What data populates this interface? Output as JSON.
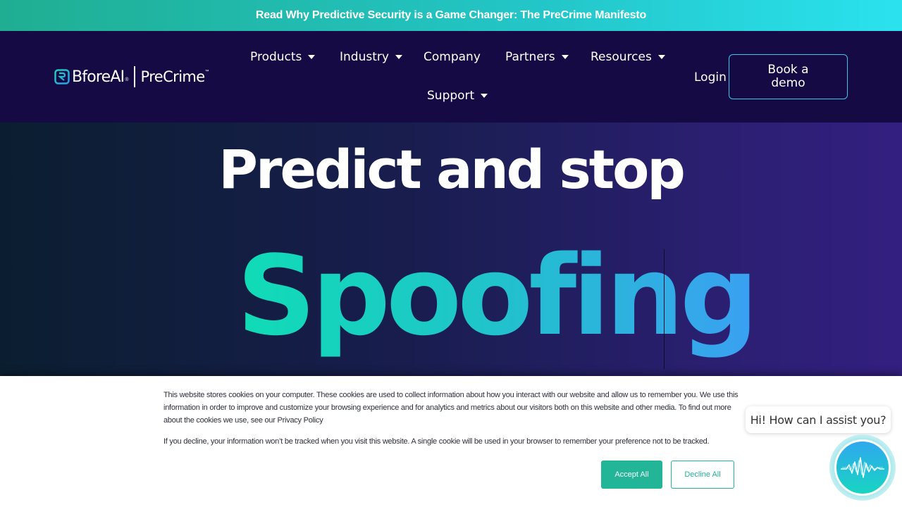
{
  "announcement": {
    "text": "Read Why Predictive Security is a Game Changer: The PreCrime Manifesto"
  },
  "header": {
    "logo": {
      "brand": "BforeAI",
      "registered": "®",
      "product": "PreCrime",
      "trademark": "™"
    },
    "nav": [
      {
        "label": "Products",
        "has_dropdown": true
      },
      {
        "label": "Industry",
        "has_dropdown": true
      },
      {
        "label": "Company",
        "has_dropdown": false
      },
      {
        "label": "Partners",
        "has_dropdown": true
      },
      {
        "label": "Resources",
        "has_dropdown": true
      },
      {
        "label": "Support",
        "has_dropdown": true
      }
    ],
    "login_label": "Login",
    "demo_label": "Book a demo"
  },
  "hero": {
    "title": "Predict and stop",
    "rotating_word": "Spoofing"
  },
  "cookie_banner": {
    "text1": "This website stores cookies on your computer. These cookies are used to collect information about how you interact with our website and allow us to remember you. We use this information in order to improve and customize your browsing experience and for analytics and metrics about our visitors both on this website and other media. To find out more about the cookies we use, see our Privacy Policy",
    "text2": "If you decline, your information won’t be tracked when you visit this website. A single cookie will be used in your browser to remember your preference not to be tracked.",
    "accept_label": "Accept All",
    "decline_label": "Decline All"
  },
  "chat": {
    "greeting": "Hi! How can I assist you?"
  },
  "colors": {
    "topbar_start": "#1fae92",
    "topbar_end": "#2ae2ee",
    "header_bg": "#150a44",
    "accent_teal": "#22b597",
    "hero_word_start": "#10dcb6",
    "hero_word_end": "#3aa0f2"
  }
}
